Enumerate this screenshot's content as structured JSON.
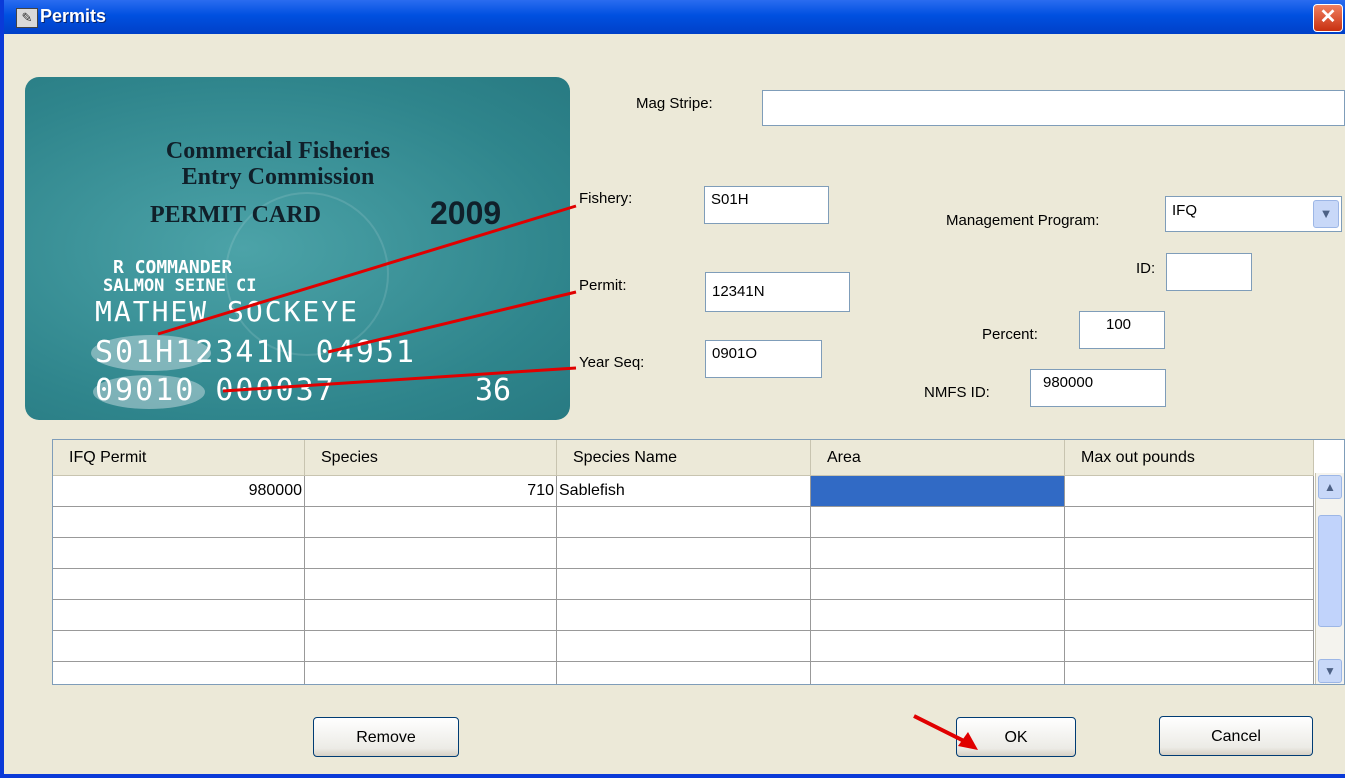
{
  "window": {
    "title": "Permits",
    "close_glyph": "✕",
    "icon": "permit-app-icon"
  },
  "card": {
    "line1": "Commercial Fisheries",
    "line2": "Entry Commission",
    "line3": "PERMIT CARD",
    "year": "2009",
    "holder_line1": "R COMMANDER",
    "holder_line2": "SALMON SEINE CI",
    "name": "MATHEW SOCKEYE",
    "code_line": "S01H12341N 04951",
    "seq_line": "09010 000037",
    "seq_suffix": "36"
  },
  "form": {
    "mag_stripe_label": "Mag Stripe:",
    "mag_stripe_value": "",
    "fishery_label": "Fishery:",
    "fishery_value": "S01H",
    "permit_label": "Permit:",
    "permit_value": "12341N",
    "year_seq_label": "Year Seq:",
    "year_seq_value": "0901O",
    "mgmt_label": "Management Program:",
    "mgmt_value": "IFQ",
    "id_label": "ID:",
    "id_value": "",
    "percent_label": "Percent:",
    "percent_value": "100",
    "nmfs_label": "NMFS ID:",
    "nmfs_value": "980000"
  },
  "table": {
    "columns": [
      "IFQ Permit",
      "Species",
      "Species Name",
      "Area",
      "Max out pounds"
    ],
    "rows": [
      [
        "980000",
        "710",
        "Sablefish",
        "",
        ""
      ],
      [
        "",
        "",
        "",
        "",
        ""
      ],
      [
        "",
        "",
        "",
        "",
        ""
      ],
      [
        "",
        "",
        "",
        "",
        ""
      ],
      [
        "",
        "",
        "",
        "",
        ""
      ],
      [
        "",
        "",
        "",
        "",
        ""
      ],
      [
        "",
        "",
        "",
        "",
        ""
      ]
    ]
  },
  "buttons": {
    "remove": "Remove",
    "ok": "OK",
    "cancel": "Cancel"
  },
  "colors": {
    "title_bar": "#0050e0",
    "selection": "#316ac5",
    "annotation": "#e00000",
    "card": "#2f858c"
  }
}
